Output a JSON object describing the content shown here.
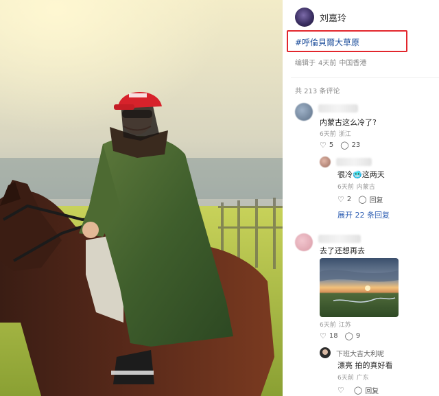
{
  "post": {
    "author_name": "刘嘉玲",
    "hashtag": "#呼倫貝爾大草原",
    "meta_edited": "编辑于",
    "meta_time": "4天前",
    "meta_location": "中国香港"
  },
  "comments_header": "共 213 条评论",
  "comments": [
    {
      "text": "内蒙古这么冷了?",
      "time": "6天前",
      "location": "浙江",
      "likes": "5",
      "replies_count": "23",
      "reply": {
        "text": "很冷🥶这两天",
        "time": "6天前",
        "location": "内蒙古",
        "likes": "2",
        "reply_label": "回复"
      },
      "expand_label": "展开 22 条回复"
    },
    {
      "text": "去了还想再去",
      "time": "6天前",
      "location": "江苏",
      "likes": "18",
      "replies_count": "9",
      "reply": {
        "author": "下班大吉大利呢",
        "text": "漂亮 拍的真好看",
        "time": "6天前",
        "location": "广东",
        "likes": "",
        "reply_label": "回复"
      }
    }
  ],
  "icons": {
    "like": "thumbs-up-icon",
    "comment": "comment-bubble-icon"
  },
  "colors": {
    "hashtag": "#1e4f9c",
    "highlight_border": "#e2262c",
    "expand_link": "#2f5fb3"
  }
}
